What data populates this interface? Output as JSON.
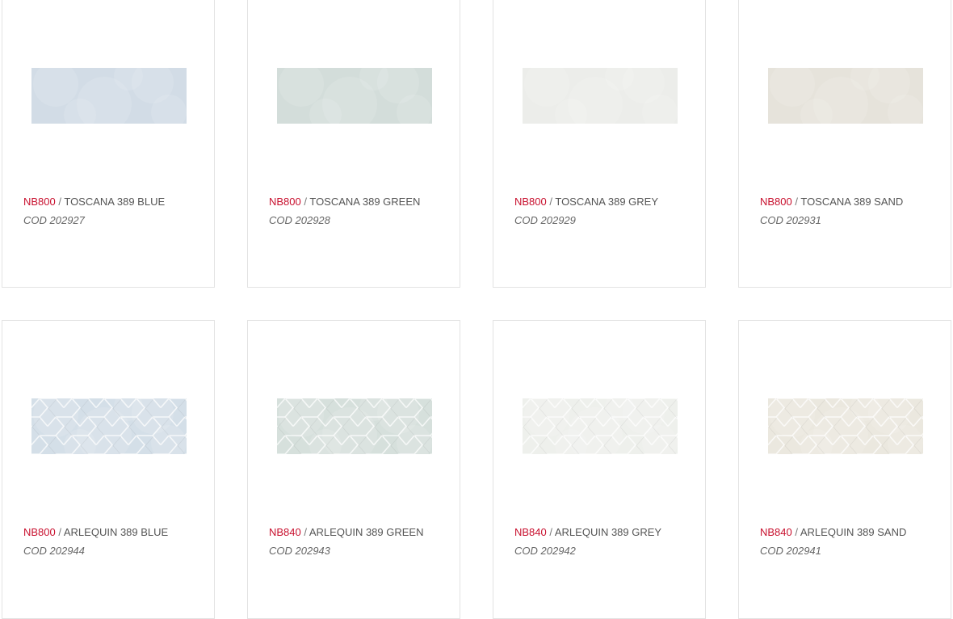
{
  "products": [
    {
      "ref": "NB800",
      "name": "TOSCANA 389 BLUE",
      "code": "COD 202927",
      "tile_color": "#d2dce6",
      "pattern": "plain"
    },
    {
      "ref": "NB800",
      "name": "TOSCANA 389 GREEN",
      "code": "COD 202928",
      "tile_color": "#d3ddda",
      "pattern": "plain"
    },
    {
      "ref": "NB800",
      "name": "TOSCANA 389 GREY",
      "code": "COD 202929",
      "tile_color": "#ecedea",
      "pattern": "plain"
    },
    {
      "ref": "NB800",
      "name": "TOSCANA 389 SAND",
      "code": "COD 202931",
      "tile_color": "#e6e3db",
      "pattern": "plain"
    },
    {
      "ref": "NB800",
      "name": "ARLEQUIN 389 BLUE",
      "code": "COD 202944",
      "tile_color": "#d4dfe8",
      "pattern": "hex"
    },
    {
      "ref": "NB840",
      "name": "ARLEQUIN 389 GREEN",
      "code": "COD 202943",
      "tile_color": "#d6e0dc",
      "pattern": "hex"
    },
    {
      "ref": "NB840",
      "name": "ARLEQUIN 389 GREY",
      "code": "COD 202942",
      "tile_color": "#eef0ec",
      "pattern": "hex"
    },
    {
      "ref": "NB840",
      "name": "ARLEQUIN 389 SAND",
      "code": "COD 202941",
      "tile_color": "#ebe8df",
      "pattern": "hex"
    }
  ],
  "separator": " / "
}
